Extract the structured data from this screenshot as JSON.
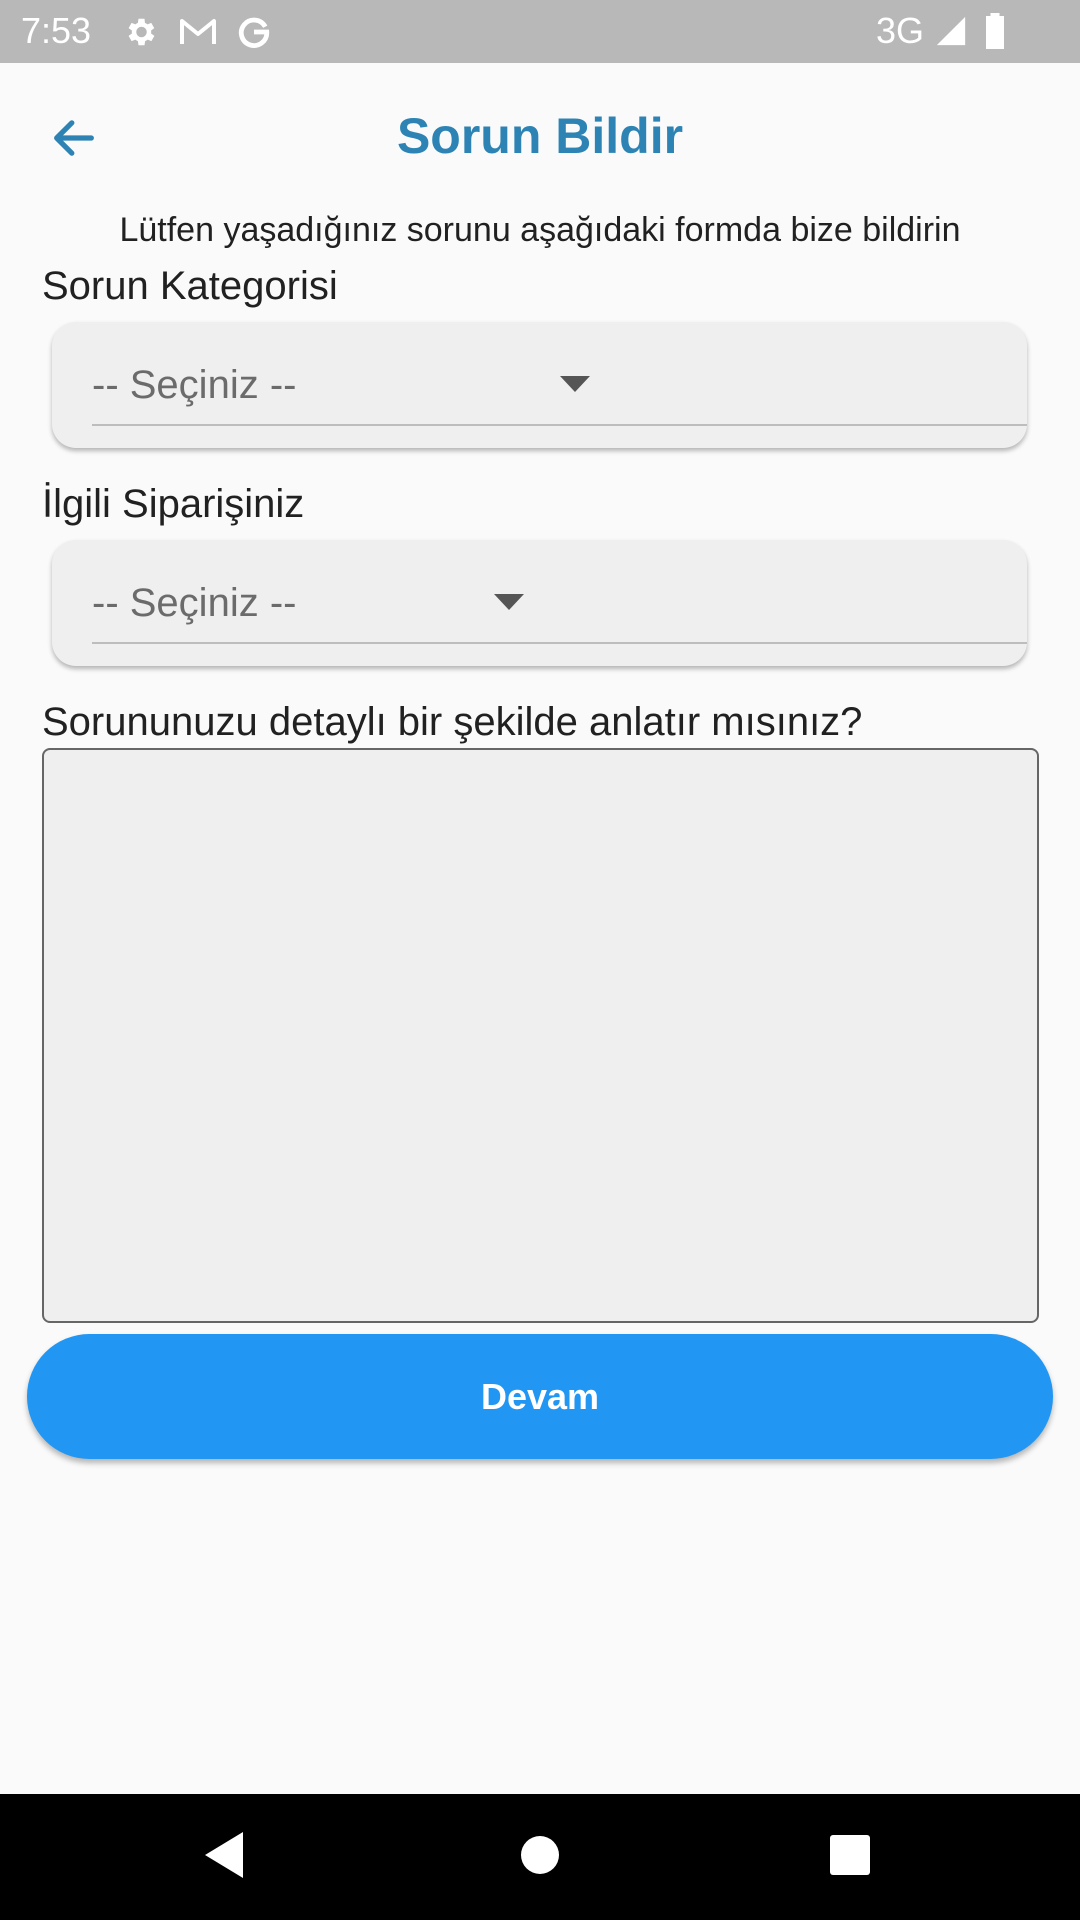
{
  "status_bar": {
    "time": "7:53",
    "network": "3G",
    "icons": [
      "gear-icon",
      "gmail-icon",
      "google-icon",
      "signal-icon",
      "battery-icon"
    ]
  },
  "app_bar": {
    "title": "Sorun Bildir",
    "back_icon": "arrow-left-icon"
  },
  "form": {
    "intro": "Lütfen yaşadığınız sorunu aşağıdaki formda bize bildirin",
    "category": {
      "label": "Sorun Kategorisi",
      "value": "-- Seçiniz --"
    },
    "order": {
      "label": "İlgili Siparişiniz",
      "value": "-- Seçiniz --"
    },
    "details": {
      "label": "Sorununuzu detaylı bir şekilde anlatır mısınız?",
      "value": ""
    },
    "continue_label": "Devam"
  },
  "nav_bar": {
    "icons": [
      "nav-back-icon",
      "nav-home-icon",
      "nav-recents-icon"
    ]
  },
  "colors": {
    "status_bar": "#b8b8b8",
    "title": "#2d84b4",
    "button": "#2196f3",
    "background": "#fafafa",
    "field_background": "#efefef"
  }
}
